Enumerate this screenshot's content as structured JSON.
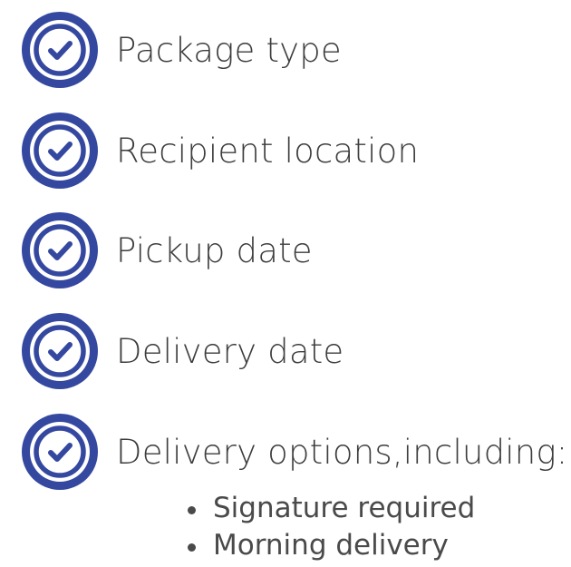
{
  "accent_color": "#3548a0",
  "items": [
    {
      "label": "Package type",
      "icon": "check-circle-icon"
    },
    {
      "label": "Recipient location",
      "icon": "check-circle-icon"
    },
    {
      "label": "Pickup date",
      "icon": "check-circle-icon"
    },
    {
      "label": "Delivery date",
      "icon": "check-circle-icon"
    },
    {
      "label": "Delivery options,including:",
      "icon": "check-circle-icon"
    }
  ],
  "sub_items": [
    "Signature required",
    "Morning delivery"
  ]
}
